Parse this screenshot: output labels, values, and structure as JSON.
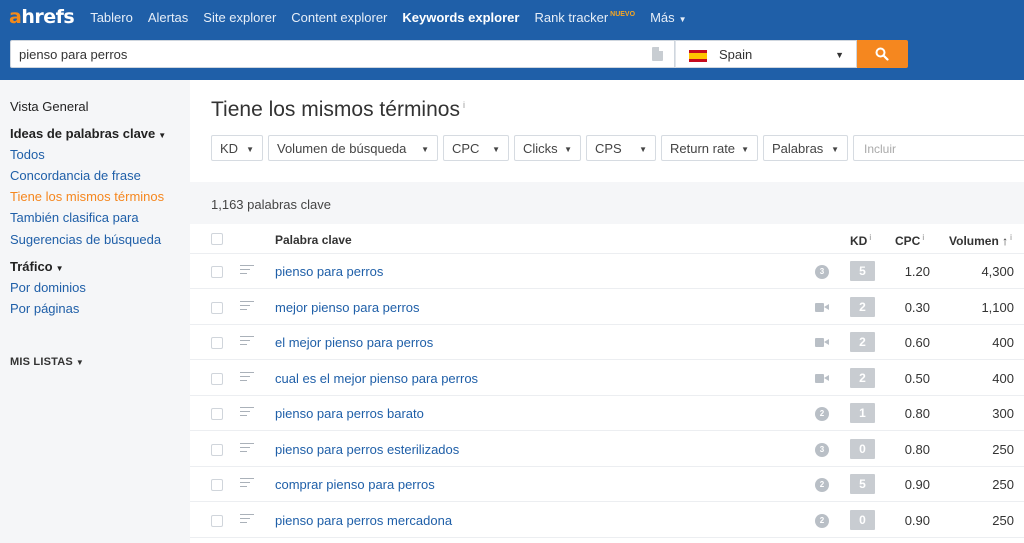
{
  "nav": {
    "logo_a": "a",
    "logo_rest": "hrefs",
    "items": [
      {
        "label": "Tablero"
      },
      {
        "label": "Alertas"
      },
      {
        "label": "Site explorer"
      },
      {
        "label": "Content explorer"
      },
      {
        "label": "Keywords explorer",
        "active": true
      },
      {
        "label": "Rank tracker",
        "badge": "NUEVO"
      },
      {
        "label": "Más"
      }
    ]
  },
  "search": {
    "value": "pienso para perros",
    "country": "Spain"
  },
  "sidebar": {
    "overview": "Vista General",
    "ideas_heading": "Ideas de palabras clave",
    "ideas_items": [
      "Todos",
      "Concordancia de frase",
      "Tiene los mismos términos",
      "También clasifica para",
      "Sugerencias de búsqueda"
    ],
    "traffic_heading": "Tráfico",
    "traffic_items": [
      "Por dominios",
      "Por páginas"
    ],
    "lists_heading": "MIS LISTAS"
  },
  "main": {
    "title": "Tiene los mismos términos",
    "title_info": "i",
    "filters": [
      "KD",
      "Volumen de búsqueda",
      "CPC",
      "Clicks",
      "CPS",
      "Return rate",
      "Palabras"
    ],
    "include_placeholder": "Incluir",
    "count": "1,163 palabras clave",
    "columns": {
      "keyword": "Palabra clave",
      "kd": "KD",
      "cpc": "CPC",
      "volume": "Volumen",
      "sort_arrow": "↑"
    },
    "rows": [
      {
        "keyword": "pienso para perros",
        "serp": "3",
        "kd": "5",
        "cpc": "1.20",
        "volume": "4,300"
      },
      {
        "keyword": "mejor pienso para perros",
        "serp": "video",
        "kd": "2",
        "cpc": "0.30",
        "volume": "1,100"
      },
      {
        "keyword": "el mejor pienso para perros",
        "serp": "video",
        "kd": "2",
        "cpc": "0.60",
        "volume": "400"
      },
      {
        "keyword": "cual es el mejor pienso para perros",
        "serp": "video",
        "kd": "2",
        "cpc": "0.50",
        "volume": "400"
      },
      {
        "keyword": "pienso para perros barato",
        "serp": "2",
        "kd": "1",
        "cpc": "0.80",
        "volume": "300"
      },
      {
        "keyword": "pienso para perros esterilizados",
        "serp": "3",
        "kd": "0",
        "cpc": "0.80",
        "volume": "250"
      },
      {
        "keyword": "comprar pienso para perros",
        "serp": "2",
        "kd": "5",
        "cpc": "0.90",
        "volume": "250"
      },
      {
        "keyword": "pienso para perros mercadona",
        "serp": "2",
        "kd": "0",
        "cpc": "0.90",
        "volume": "250"
      }
    ]
  },
  "colors": {
    "nav_blue": "#1f5fa8",
    "accent_orange": "#f5871f"
  }
}
